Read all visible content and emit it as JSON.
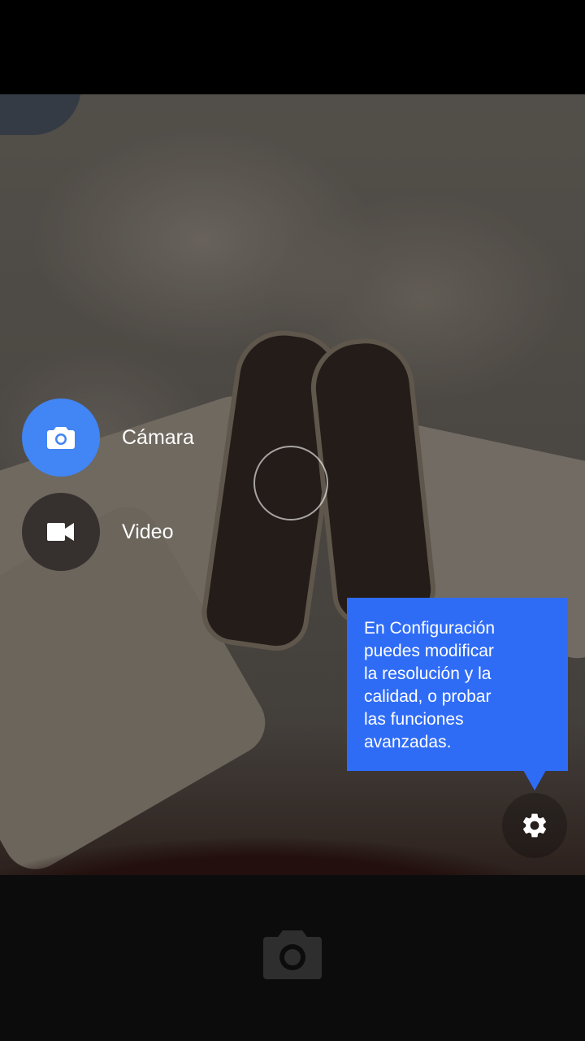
{
  "modes": {
    "camera": {
      "label": "Cámara",
      "icon": "camera-icon"
    },
    "video": {
      "label": "Video",
      "icon": "videocam-icon"
    }
  },
  "tooltip": {
    "lines": [
      "En Configuración",
      "puedes modificar",
      "la resolución y la",
      "calidad, o probar",
      "las funciones",
      "avanzadas."
    ]
  },
  "settings": {
    "icon": "gear-icon"
  },
  "shutter": {
    "icon": "camera-shutter-icon"
  },
  "colors": {
    "accent": "#4285f4",
    "tooltip_bg": "#2f6cf6",
    "bottom_bar": "#0c0c0c"
  }
}
